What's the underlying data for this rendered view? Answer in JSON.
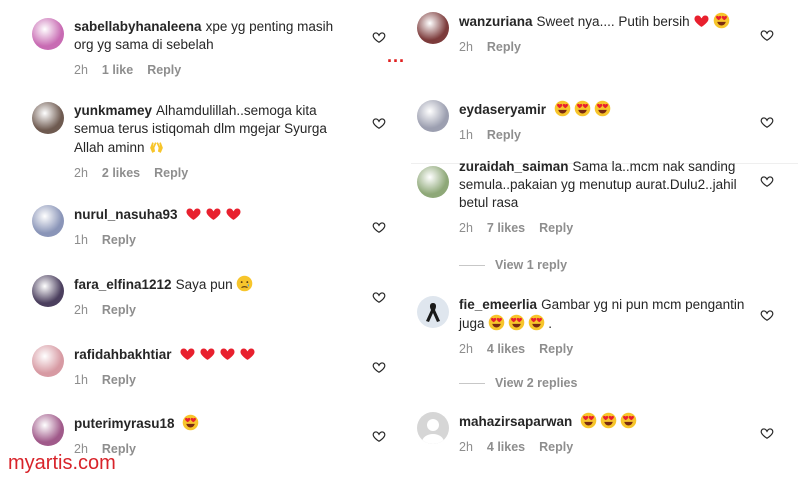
{
  "watermark": "myartis.com",
  "separator": "...",
  "left": [
    {
      "user": "sabellabyhanaleena",
      "text": "xpe yg penting masih org yg sama di sebelah",
      "time": "2h",
      "likes": "1 like",
      "reply": "Reply",
      "avatar_color": "#c86bb3",
      "emoji": "",
      "emoji_count": 0
    },
    {
      "user": "yunkmamey",
      "text": "Alhamdulillah..semoga kita semua terus istiqomah dlm mgejar Syurga Allah aminn",
      "time": "2h",
      "likes": "2 likes",
      "reply": "Reply",
      "avatar_color": "#6e5a50",
      "emoji": "hands",
      "emoji_count": 1
    },
    {
      "user": "nurul_nasuha93",
      "text": "",
      "time": "1h",
      "likes": "",
      "reply": "Reply",
      "avatar_color": "#8a95b8",
      "emoji": "heart",
      "emoji_count": 3
    },
    {
      "user": "fara_elfina1212",
      "text": "Saya pun",
      "time": "2h",
      "likes": "",
      "reply": "Reply",
      "avatar_color": "#4b3f5e",
      "emoji": "cry",
      "emoji_count": 1
    },
    {
      "user": "rafidahbakhtiar",
      "text": "",
      "time": "1h",
      "likes": "",
      "reply": "Reply",
      "avatar_color": "#d79aa3",
      "emoji": "heart",
      "emoji_count": 4
    },
    {
      "user": "puterimyrasu18",
      "text": "",
      "time": "2h",
      "likes": "",
      "reply": "Reply",
      "avatar_color": "#a05a8a",
      "emoji": "hearteyes",
      "emoji_count": 1
    }
  ],
  "right": [
    {
      "user": "wanzuriana",
      "text": "Sweet nya.... Putih bersih",
      "time": "2h",
      "likes": "",
      "reply": "Reply",
      "avatar_color": "#7c3b3b",
      "emoji": "heart-hearteyes",
      "emoji_count": 2
    },
    {
      "user": "eydaseryamir",
      "text": "",
      "time": "1h",
      "likes": "",
      "reply": "Reply",
      "avatar_color": "#9c9fb0",
      "emoji": "hearteyes",
      "emoji_count": 3
    },
    {
      "user": "zuraidah_saiman",
      "text": "Sama la..mcm nak sanding semula..pakaian yg menutup aurat.Dulu2..jahil betul rasa",
      "time": "2h",
      "likes": "7 likes",
      "reply": "Reply",
      "avatar_color": "#8ea878",
      "emoji": "",
      "emoji_count": 0,
      "view_replies": "View 1 reply"
    },
    {
      "user": "fie_emeerlia",
      "text": "Gambar yg ni pun mcm pengantin juga",
      "text_after": ".",
      "time": "2h",
      "likes": "4 likes",
      "reply": "Reply",
      "avatar_color": "#dfe6ee",
      "emoji": "hearteyes",
      "emoji_count": 3,
      "view_replies": "View 2 replies"
    },
    {
      "user": "mahazirsaparwan",
      "text": "",
      "time": "2h",
      "likes": "4 likes",
      "reply": "Reply",
      "avatar_color": "#d6d6d6",
      "emoji": "hearteyes",
      "emoji_count": 3
    }
  ]
}
